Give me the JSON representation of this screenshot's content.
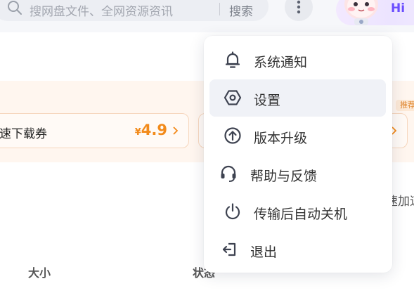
{
  "search": {
    "placeholder": "搜网盘文件、全网资源资讯",
    "button_label": "搜索"
  },
  "header": {
    "greeting": "Hi",
    "more_icon": "more-vertical-icon",
    "mascot": "mascot-avatar"
  },
  "promo": {
    "coupon_label": "速下载券",
    "coupon_currency": "¥",
    "coupon_price": "4.9",
    "recommend_tag": "推荐",
    "side_text": "速加速"
  },
  "table": {
    "columns": [
      "大小",
      "状态"
    ]
  },
  "menu": {
    "items": [
      {
        "label": "系统通知",
        "icon": "bell-icon",
        "active": false
      },
      {
        "label": "设置",
        "icon": "settings-hexagon-icon",
        "active": true
      },
      {
        "label": "版本升级",
        "icon": "upgrade-arrow-icon",
        "active": false
      },
      {
        "label": "帮助与反馈",
        "icon": "headset-icon",
        "active": false
      },
      {
        "label": "传输后自动关机",
        "icon": "power-icon",
        "active": false
      },
      {
        "label": "退出",
        "icon": "logout-icon",
        "active": false
      }
    ]
  },
  "colors": {
    "accent_orange": "#f28a1a",
    "greeting_purple": "#6a4dff",
    "menu_active_bg": "#f0f2f7"
  }
}
